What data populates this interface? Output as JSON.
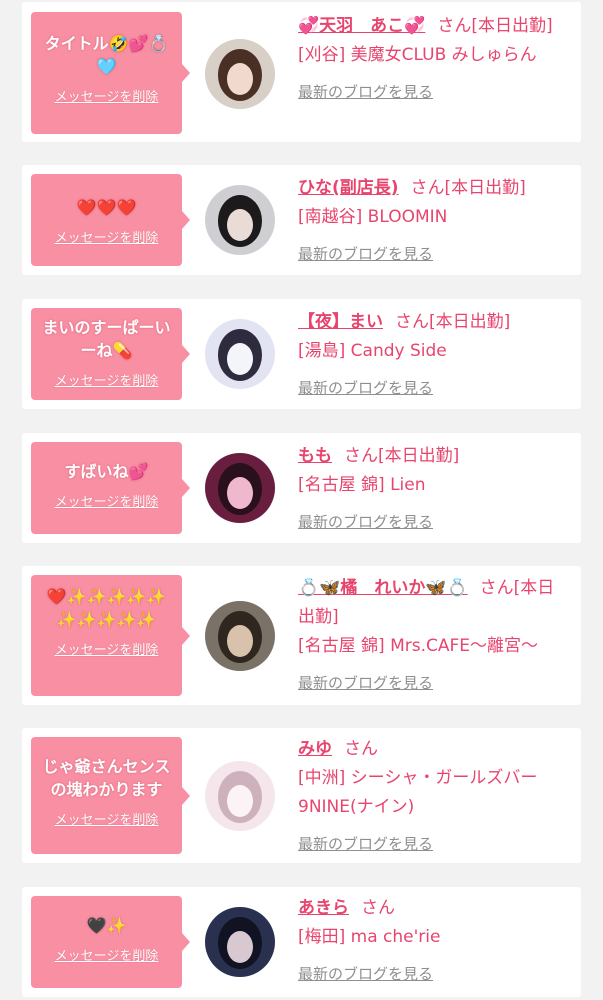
{
  "messages": [
    {
      "bubble_text": "タイトル🤣💕💍🩵",
      "delete_label": "メッセージを削除",
      "name": "💞天羽　あこ💞",
      "honorific": "さん",
      "status": "[本日出勤]",
      "shop": "[刈谷] 美魔女CLUB みしゅらん",
      "blog_label": "最新のブログを見る"
    },
    {
      "bubble_text": "❤️❤️❤️",
      "delete_label": "メッセージを削除",
      "name": "ひな(副店長)",
      "honorific": "さん",
      "status": "[本日出勤]",
      "shop": "[南越谷] BLOOMIN",
      "blog_label": "最新のブログを見る"
    },
    {
      "bubble_text": "まいのすーぱーいーね💊",
      "delete_label": "メッセージを削除",
      "name": "【夜】まい",
      "honorific": "さん",
      "status": "[本日出勤]",
      "shop": "[湯島] Candy Side",
      "blog_label": "最新のブログを見る"
    },
    {
      "bubble_text": "すばいね💕",
      "delete_label": "メッセージを削除",
      "name": "もも",
      "honorific": "さん",
      "status": "[本日出勤]",
      "shop": "[名古屋 錦] Lien",
      "blog_label": "最新のブログを見る"
    },
    {
      "bubble_text": "❤️✨✨✨✨✨✨✨✨✨✨",
      "delete_label": "メッセージを削除",
      "name": "💍🦋橘　れいか🦋💍",
      "honorific": "さん",
      "status": "[本日出勤]",
      "shop": "[名古屋 錦] Mrs.CAFE〜離宮〜",
      "blog_label": "最新のブログを見る"
    },
    {
      "bubble_text": "じゃ爺さんセンスの塊わかります",
      "delete_label": "メッセージを削除",
      "name": "みゆ",
      "honorific": "さん",
      "status": "",
      "shop": "[中洲] シーシャ・ガールズバー9NINE(ナイン)",
      "blog_label": "最新のブログを見る"
    },
    {
      "bubble_text": "🖤✨",
      "delete_label": "メッセージを削除",
      "name": "あきら",
      "honorific": "さん",
      "status": "",
      "shop": "[梅田] ma che'rie",
      "blog_label": "最新のブログを見る"
    }
  ],
  "colors": {
    "page_background": "#f2f2f2",
    "card_background": "#ffffff",
    "bubble": "#f88fa2",
    "name_text": "#e8456e",
    "blog_link": "#8f8f8f"
  },
  "avatars": [
    {
      "icon": "avatar-photo",
      "palette": [
        "#d8cfc6",
        "#4a2f25",
        "#f1d9cd"
      ]
    },
    {
      "icon": "avatar-photo",
      "palette": [
        "#cfcfd3",
        "#1d1a1c",
        "#e9dcd6"
      ]
    },
    {
      "icon": "avatar-photo",
      "palette": [
        "#e2e3f3",
        "#2d2b3d",
        "#f4f4fb"
      ]
    },
    {
      "icon": "avatar-photo",
      "palette": [
        "#6a1e3f",
        "#2a0f1d",
        "#efb8cc"
      ]
    },
    {
      "icon": "avatar-photo",
      "palette": [
        "#7a7266",
        "#2f261f",
        "#d9c2ac"
      ]
    },
    {
      "icon": "avatar-photo",
      "palette": [
        "#f5e6ec",
        "#cdb2bd",
        "#fbf3f6"
      ]
    },
    {
      "icon": "avatar-photo",
      "palette": [
        "#2a3050",
        "#111222",
        "#d8c8cf"
      ]
    }
  ]
}
